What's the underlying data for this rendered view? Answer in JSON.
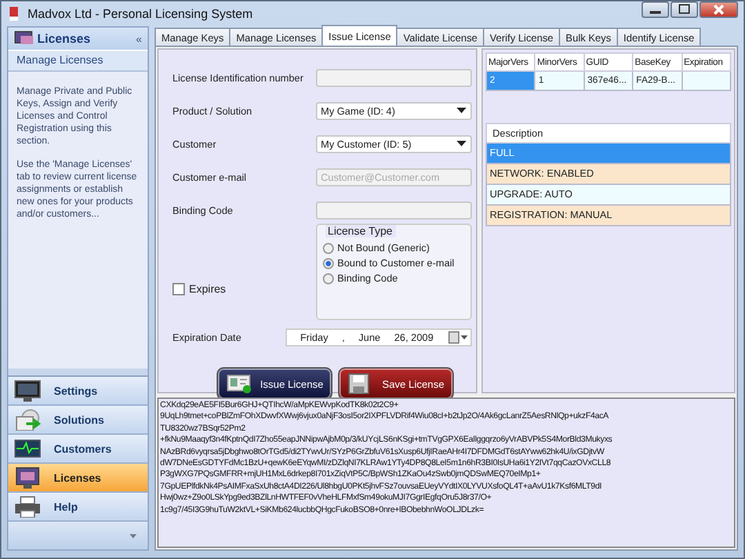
{
  "window": {
    "title": "Madvox Ltd - Personal Licensing System"
  },
  "sidebar": {
    "title": "Licenses",
    "subtitle": "Manage Licenses",
    "collapse_glyph": "«",
    "paragraphs": [
      "Manage Private and Public Keys, Assign and Verify Licenses and Control Registration using this section.",
      "Use the 'Manage Licenses' tab to review current license assignments or establish new ones for your products and/or customers..."
    ],
    "nav": [
      {
        "label": "Settings",
        "kind": "monitor",
        "selected": false
      },
      {
        "label": "Solutions",
        "kind": "disc",
        "selected": false
      },
      {
        "label": "Customers",
        "kind": "pulse",
        "selected": false
      },
      {
        "label": "Licenses",
        "kind": "screen",
        "selected": true
      },
      {
        "label": "Help",
        "kind": "printer",
        "selected": false
      }
    ]
  },
  "tabs": [
    {
      "label": "Manage Keys",
      "selected": false
    },
    {
      "label": "Manage Licenses",
      "selected": false
    },
    {
      "label": "Issue License",
      "selected": true
    },
    {
      "label": "Validate License",
      "selected": false
    },
    {
      "label": "Verify License",
      "selected": false
    },
    {
      "label": "Bulk Keys",
      "selected": false
    },
    {
      "label": "Identify License",
      "selected": false
    }
  ],
  "form": {
    "fields": [
      {
        "label": "License Identification number",
        "kind": "text",
        "disabled": true
      },
      {
        "label": "Product / Solution",
        "kind": "dropdown",
        "value": "My Game (ID: 4)",
        "disabled": false
      },
      {
        "label": "Customer",
        "kind": "dropdown",
        "value": "My Customer (ID: 5)",
        "disabled": false
      },
      {
        "label": "Customer e-mail",
        "kind": "text",
        "placeholder": "Customer@Customer.com",
        "disabled": true
      },
      {
        "label": "Binding Code",
        "kind": "text",
        "disabled": true
      }
    ],
    "license_type": {
      "title": "License Type",
      "options": [
        {
          "label": "Not Bound (Generic)",
          "selected": false
        },
        {
          "label": "Bound to Customer e-mail",
          "selected": true
        },
        {
          "label": "Binding Code",
          "selected": false
        }
      ]
    },
    "expires": {
      "label": "Expires",
      "checked": false
    },
    "expiration_date": {
      "label": "Expiration Date",
      "parts": [
        "Friday",
        ",",
        "June",
        "26, 2009"
      ]
    },
    "buttons": [
      {
        "label": "Issue License",
        "kind": "issue"
      },
      {
        "label": "Save License",
        "kind": "save"
      }
    ]
  },
  "grid": {
    "columns": [
      "MajorVers",
      "MinorVers",
      "GUID",
      "BaseKey",
      "Expiration"
    ],
    "rows": [
      {
        "cells": [
          "2",
          "1",
          "367e46...",
          "FA29-B...",
          ""
        ],
        "selected": true
      }
    ]
  },
  "description": {
    "header": "Description",
    "items": [
      {
        "text": "FULL",
        "selected": true
      },
      {
        "text": "NETWORK: ENABLED",
        "selected": false
      },
      {
        "text": "UPGRADE: AUTO",
        "selected": false
      },
      {
        "text": "REGISTRATION: MANUAL",
        "selected": false
      }
    ]
  },
  "license_key": "CXKdq29eAE5FI5Bur6GHJ+QTIhcW/aMpKEWvpKodTK8k02t2C9+\n9UqLh9tmet+coPBlZmFOhXDwvfXWwj6vjux0aNjF3osI5or2IXPFLVDRif4Wiu08cI+b2tJp2O/4Ak6gcLanrZ5AesRNlQp+ukzF4acA\nTU8320wz7BSqr52Pm2\n+fkNu9Maaqyf3n4fKptnQdI7Zho55eapJNNipwAjbM0p/3/kUYcjLS6nKSgi+tmTVgGPX6EaIlggqrzo6yVrABVPk5S4MorBld3Mukyxs\nNAzBRd6vyqrsa5jDbghwo8tOrTGd5/di2TYwvUr/SYzP6GrZbfuV61sXusp6UfjIRaeAHr4I7DFDMGdT6stAYww62hk4U/ixGDjtvW\ndW7DNeEsGDTYFdMc1BzU+qewK6eEYqwMI/zDZlqNI7KLRAw1YTy4DP8Q8LeI5m1n6hR3BI0IsUHa6i1Y2IVt7qqCazOVxCLL8\nP3gWXG7PQsGMFRR+mjUH1MxL6drkep8I701xZiqVtP5C/BpWSh1ZKaOu4zSwb0jmQDSwMEQ70eIMp1+\n7GpUEPlfdkNk4PsAIMFxaSxUh8ctA4DI226/Ul8hbgU0PKt5jhvFSz7ouvsaEUeyVYdtIX0LYVUXsfoQL4T+aAvU1k7Ksf6MLT9dI\nHwj0wz+Z9o0LSkYpg9ed3BZlLnHWTFEF0vVheHLFMxfSm49okuMJI7GgrIEgfqOru5J8r37/O+\n1c9g7/45I3G9huTuW2ktVL+SiKMb624lucbbQHgcFukoBSO8+0nre+lBObebhnWoOLJDLzk="
}
